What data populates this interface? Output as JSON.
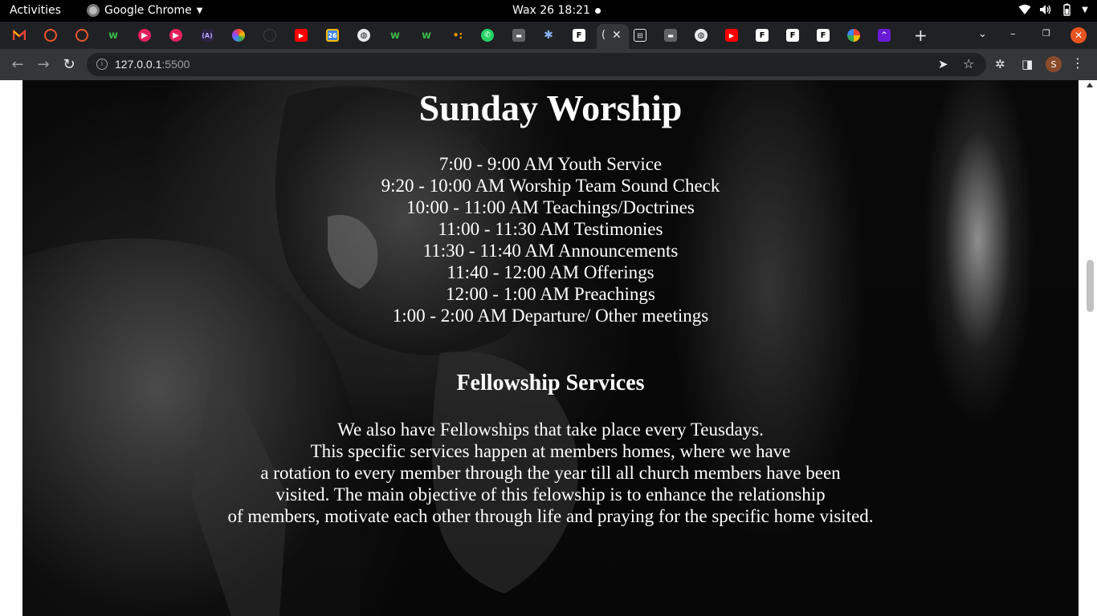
{
  "system": {
    "activities": "Activities",
    "app_name": "Google Chrome",
    "clock": "Wax 26  18:21"
  },
  "browser": {
    "tab_icons": [
      "gmail-icon",
      "ubuntu-icon",
      "ubuntu-icon",
      "webflow-icon",
      "music-icon",
      "music-icon",
      "code-icon",
      "photos-icon",
      "github-icon",
      "youtube-icon",
      "calendar-icon",
      "globe-icon",
      "webflow-icon",
      "webflow-icon",
      "dots-icon",
      "whatsapp-icon",
      "game-icon",
      "puzzle-icon",
      "figma-file-icon"
    ],
    "active_tab_label": "(",
    "right_tab_icons": [
      "window-icon",
      "game-icon",
      "globe-icon",
      "youtube-icon",
      "figma-file-icon",
      "figma-file-icon",
      "figma-file-icon",
      "google-icon",
      "app-icon"
    ],
    "url_host": "127.0.0.1",
    "url_port": ":5500",
    "profile_initial": "S"
  },
  "page": {
    "title": "Sunday Worship",
    "schedule": [
      "7:00 - 9:00 AM Youth Service",
      "9:20 - 10:00 AM Worship Team Sound Check",
      "10:00 - 11:00 AM Teachings/Doctrines",
      "11:00 - 11:30 AM Testimonies",
      "11:30 - 11:40 AM Announcements",
      "11:40 - 12:00 AM Offerings",
      "12:00 - 1:00 AM Preachings",
      "1:00 - 2:00 AM Departure/ Other meetings"
    ],
    "fellowship": {
      "title": "Fellowship Services",
      "lines": [
        "We also have Fellowships that take place every Teusdays.",
        "This specific services happen at members homes, where we have",
        "a rotation to every member through the year till all church members have been",
        "visited. The main objective of this felowship is to enhance the relationship",
        "of members, motivate each other through life and praying for the specific home visited."
      ]
    }
  }
}
